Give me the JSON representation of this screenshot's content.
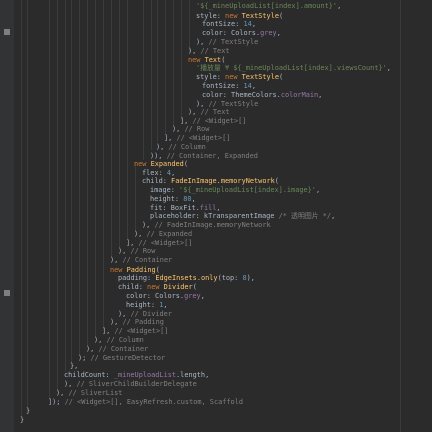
{
  "editor": {
    "language": "dart",
    "colors": {
      "background": "#2b2b2b",
      "keyword": "#cc7832",
      "type": "#ffc66d",
      "identifier": "#a9b7c6",
      "string": "#6a8759",
      "number": "#6897bb",
      "comment": "#808080",
      "property": "#9876aa"
    },
    "gutter_icons": [
      "breakpoint-marker-icon",
      "breakpoint-marker-icon"
    ],
    "lines": [
      [
        {
          "t": "'${_mineUploadList[index].amount}'",
          "c": "st"
        },
        {
          "t": ",",
          "c": "pn"
        }
      ],
      [
        {
          "t": "style: ",
          "c": "id"
        },
        {
          "t": "new ",
          "c": "kw"
        },
        {
          "t": "TextStyle",
          "c": "ty"
        },
        {
          "t": "(",
          "c": "pn"
        }
      ],
      [
        {
          "t": "fontSize: ",
          "c": "id"
        },
        {
          "t": "14",
          "c": "nu"
        },
        {
          "t": ",",
          "c": "pn"
        }
      ],
      [
        {
          "t": "color: Colors.",
          "c": "id"
        },
        {
          "t": "grey",
          "c": "pr"
        },
        {
          "t": ",",
          "c": "pn"
        }
      ],
      [
        {
          "t": "), ",
          "c": "pn"
        },
        {
          "t": "// TextStyle",
          "c": "cm"
        }
      ],
      [
        {
          "t": "), ",
          "c": "pn"
        },
        {
          "t": "// Text",
          "c": "cm"
        }
      ],
      [
        {
          "t": "new ",
          "c": "kw"
        },
        {
          "t": "Text",
          "c": "ty"
        },
        {
          "t": "(",
          "c": "pn"
        }
      ],
      [
        {
          "t": "'播放量 ¥ ${_mineUploadList[index].viewsCount}'",
          "c": "st"
        },
        {
          "t": ",",
          "c": "pn"
        }
      ],
      [
        {
          "t": "style: ",
          "c": "id"
        },
        {
          "t": "new ",
          "c": "kw"
        },
        {
          "t": "TextStyle",
          "c": "ty"
        },
        {
          "t": "(",
          "c": "pn"
        }
      ],
      [
        {
          "t": "fontSize: ",
          "c": "id"
        },
        {
          "t": "14",
          "c": "nu"
        },
        {
          "t": ",",
          "c": "pn"
        }
      ],
      [
        {
          "t": "color: ThemeColors.",
          "c": "id"
        },
        {
          "t": "colorMain",
          "c": "pr"
        },
        {
          "t": ",",
          "c": "pn"
        }
      ],
      [
        {
          "t": "), ",
          "c": "pn"
        },
        {
          "t": "// TextStyle",
          "c": "cm"
        }
      ],
      [
        {
          "t": "), ",
          "c": "pn"
        },
        {
          "t": "// Text",
          "c": "cm"
        }
      ],
      [
        {
          "t": "], ",
          "c": "pn"
        },
        {
          "t": "// <Widget>[]",
          "c": "cm"
        }
      ],
      [
        {
          "t": "), ",
          "c": "pn"
        },
        {
          "t": "// Row",
          "c": "cm"
        }
      ],
      [
        {
          "t": "], ",
          "c": "pn"
        },
        {
          "t": "// <Widget>[]",
          "c": "cm"
        }
      ],
      [
        {
          "t": "), ",
          "c": "pn"
        },
        {
          "t": "// Column",
          "c": "cm"
        }
      ],
      [
        {
          "t": ")), ",
          "c": "pn"
        },
        {
          "t": "// Container, Expanded",
          "c": "cm"
        }
      ],
      [
        {
          "t": "new ",
          "c": "kw"
        },
        {
          "t": "Expanded",
          "c": "ty"
        },
        {
          "t": "(",
          "c": "pn"
        }
      ],
      [
        {
          "t": "flex: ",
          "c": "id"
        },
        {
          "t": "4",
          "c": "nu"
        },
        {
          "t": ",",
          "c": "pn"
        }
      ],
      [
        {
          "t": "child: ",
          "c": "id"
        },
        {
          "t": "FadeInImage.memoryNetwork",
          "c": "fn"
        },
        {
          "t": "(",
          "c": "pn"
        }
      ],
      [
        {
          "t": "image: ",
          "c": "id"
        },
        {
          "t": "'${_mineUploadList[index].image}'",
          "c": "st"
        },
        {
          "t": ",",
          "c": "pn"
        }
      ],
      [
        {
          "t": "height: ",
          "c": "id"
        },
        {
          "t": "80",
          "c": "nu"
        },
        {
          "t": ",",
          "c": "pn"
        }
      ],
      [
        {
          "t": "fit: BoxFit.",
          "c": "id"
        },
        {
          "t": "fill",
          "c": "pr"
        },
        {
          "t": ",",
          "c": "pn"
        }
      ],
      [
        {
          "t": "placeholder: kTransparentImage ",
          "c": "id"
        },
        {
          "t": "/* 透明图片 */",
          "c": "cm"
        },
        {
          "t": ",",
          "c": "pn"
        }
      ],
      [
        {
          "t": "), ",
          "c": "pn"
        },
        {
          "t": "// FadeInImage.memoryNetwork",
          "c": "cm"
        }
      ],
      [
        {
          "t": "), ",
          "c": "pn"
        },
        {
          "t": "// Expanded",
          "c": "cm"
        }
      ],
      [
        {
          "t": "], ",
          "c": "pn"
        },
        {
          "t": "// <Widget>[]",
          "c": "cm"
        }
      ],
      [
        {
          "t": "), ",
          "c": "pn"
        },
        {
          "t": "// Row",
          "c": "cm"
        }
      ],
      [
        {
          "t": "), ",
          "c": "pn"
        },
        {
          "t": "// Container",
          "c": "cm"
        }
      ],
      [
        {
          "t": "new ",
          "c": "kw"
        },
        {
          "t": "Padding",
          "c": "ty"
        },
        {
          "t": "(",
          "c": "pn"
        }
      ],
      [
        {
          "t": "padding: ",
          "c": "id"
        },
        {
          "t": "EdgeInsets.only",
          "c": "fn"
        },
        {
          "t": "(top: ",
          "c": "id"
        },
        {
          "t": "8",
          "c": "nu"
        },
        {
          "t": "),",
          "c": "pn"
        }
      ],
      [
        {
          "t": "child: ",
          "c": "id"
        },
        {
          "t": "new ",
          "c": "kw"
        },
        {
          "t": "Divider",
          "c": "ty"
        },
        {
          "t": "(",
          "c": "pn"
        }
      ],
      [
        {
          "t": "color: Colors.",
          "c": "id"
        },
        {
          "t": "grey",
          "c": "pr"
        },
        {
          "t": ",",
          "c": "pn"
        }
      ],
      [
        {
          "t": "height: ",
          "c": "id"
        },
        {
          "t": "1",
          "c": "nu"
        },
        {
          "t": ",",
          "c": "pn"
        }
      ],
      [
        {
          "t": "), ",
          "c": "pn"
        },
        {
          "t": "// Divider",
          "c": "cm"
        }
      ],
      [
        {
          "t": "), ",
          "c": "pn"
        },
        {
          "t": "// Padding",
          "c": "cm"
        }
      ],
      [
        {
          "t": "], ",
          "c": "pn"
        },
        {
          "t": "// <Widget>[]",
          "c": "cm"
        }
      ],
      [
        {
          "t": "), ",
          "c": "pn"
        },
        {
          "t": "// Column",
          "c": "cm"
        }
      ],
      [
        {
          "t": "), ",
          "c": "pn"
        },
        {
          "t": "// Container",
          "c": "cm"
        }
      ],
      [
        {
          "t": "); ",
          "c": "pn"
        },
        {
          "t": "// GestureDetector",
          "c": "cm"
        }
      ],
      [
        {
          "t": "},",
          "c": "pn"
        }
      ],
      [
        {
          "t": "childCount: ",
          "c": "id"
        },
        {
          "t": "_mineUploadList",
          "c": "pr"
        },
        {
          "t": ".length,",
          "c": "id"
        }
      ],
      [
        {
          "t": "), ",
          "c": "pn"
        },
        {
          "t": "// SliverChildBuilderDelegate",
          "c": "cm"
        }
      ],
      [
        {
          "t": "), ",
          "c": "pn"
        },
        {
          "t": "// SliverList",
          "c": "cm"
        }
      ],
      [
        {
          "t": "]); ",
          "c": "pn"
        },
        {
          "t": "// <Widget>[], EasyRefresh.custom, Scaffold",
          "c": "cm"
        }
      ],
      [
        {
          "t": "}",
          "c": "pn"
        }
      ],
      [
        {
          "t": "}",
          "c": "pn"
        }
      ]
    ]
  }
}
